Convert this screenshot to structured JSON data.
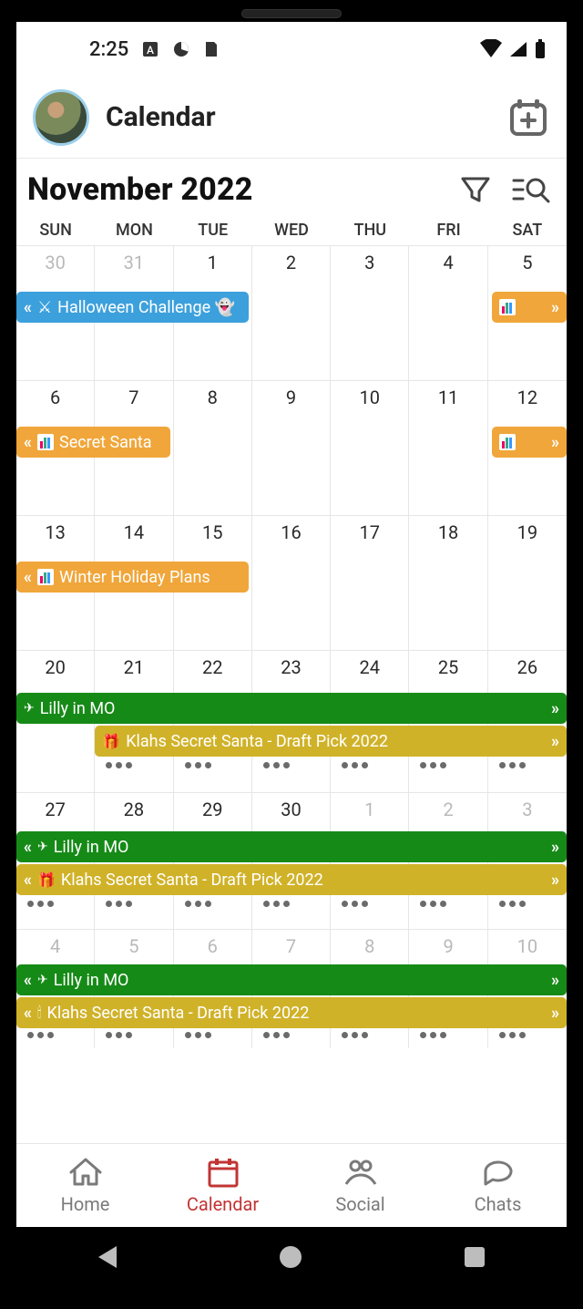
{
  "status": {
    "time": "2:25"
  },
  "header": {
    "title": "Calendar"
  },
  "month_title": "November 2022",
  "weekdays": [
    "SUN",
    "MON",
    "TUE",
    "WED",
    "THU",
    "FRI",
    "SAT"
  ],
  "weeks": [
    {
      "days": [
        "30",
        "31",
        "1",
        "2",
        "3",
        "4",
        "5"
      ],
      "dim": [
        true,
        true,
        false,
        false,
        false,
        false,
        false
      ]
    },
    {
      "days": [
        "6",
        "7",
        "8",
        "9",
        "10",
        "11",
        "12"
      ],
      "dim": [
        false,
        false,
        false,
        false,
        false,
        false,
        false
      ]
    },
    {
      "days": [
        "13",
        "14",
        "15",
        "16",
        "17",
        "18",
        "19"
      ],
      "dim": [
        false,
        false,
        false,
        false,
        false,
        false,
        false
      ]
    },
    {
      "days": [
        "20",
        "21",
        "22",
        "23",
        "24",
        "25",
        "26"
      ],
      "dim": [
        false,
        false,
        false,
        false,
        false,
        false,
        false
      ]
    },
    {
      "days": [
        "27",
        "28",
        "29",
        "30",
        "1",
        "2",
        "3"
      ],
      "dim": [
        false,
        false,
        false,
        false,
        true,
        true,
        true
      ]
    },
    {
      "days": [
        "4",
        "5",
        "6",
        "7",
        "8",
        "9",
        "10"
      ],
      "dim": [
        true,
        true,
        true,
        true,
        true,
        true,
        true
      ]
    }
  ],
  "events": {
    "w0_halloween": "Halloween Challenge 👻",
    "w1_secret": "Secret Santa",
    "w2_winter": "Winter Holiday Plans",
    "lilly": "Lilly in MO",
    "klahs": "Klahs Secret Santa - Draft Pick 2022"
  },
  "icons": {
    "swords": "⚔",
    "gift": "🎁",
    "candles": "🕯"
  },
  "tabs": {
    "home": "Home",
    "calendar": "Calendar",
    "social": "Social",
    "chats": "Chats"
  }
}
